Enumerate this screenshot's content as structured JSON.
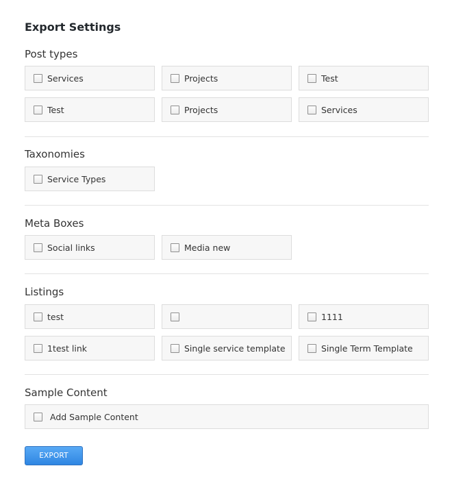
{
  "title": "Export Settings",
  "sections": {
    "post_types": {
      "label": "Post types",
      "items": [
        "Services",
        "Projects",
        "Test",
        "Test",
        "Projects",
        "Services"
      ]
    },
    "taxonomies": {
      "label": "Taxonomies",
      "items": [
        "Service Types"
      ]
    },
    "meta_boxes": {
      "label": "Meta Boxes",
      "items": [
        "Social links",
        "Media new"
      ]
    },
    "listings": {
      "label": "Listings",
      "items": [
        "test",
        "",
        "1111",
        "1test link",
        "Single service template",
        "Single Term Template"
      ]
    },
    "sample_content": {
      "label": "Sample Content",
      "items": [
        "Add Sample Content"
      ]
    }
  },
  "export_button": "EXPORT"
}
